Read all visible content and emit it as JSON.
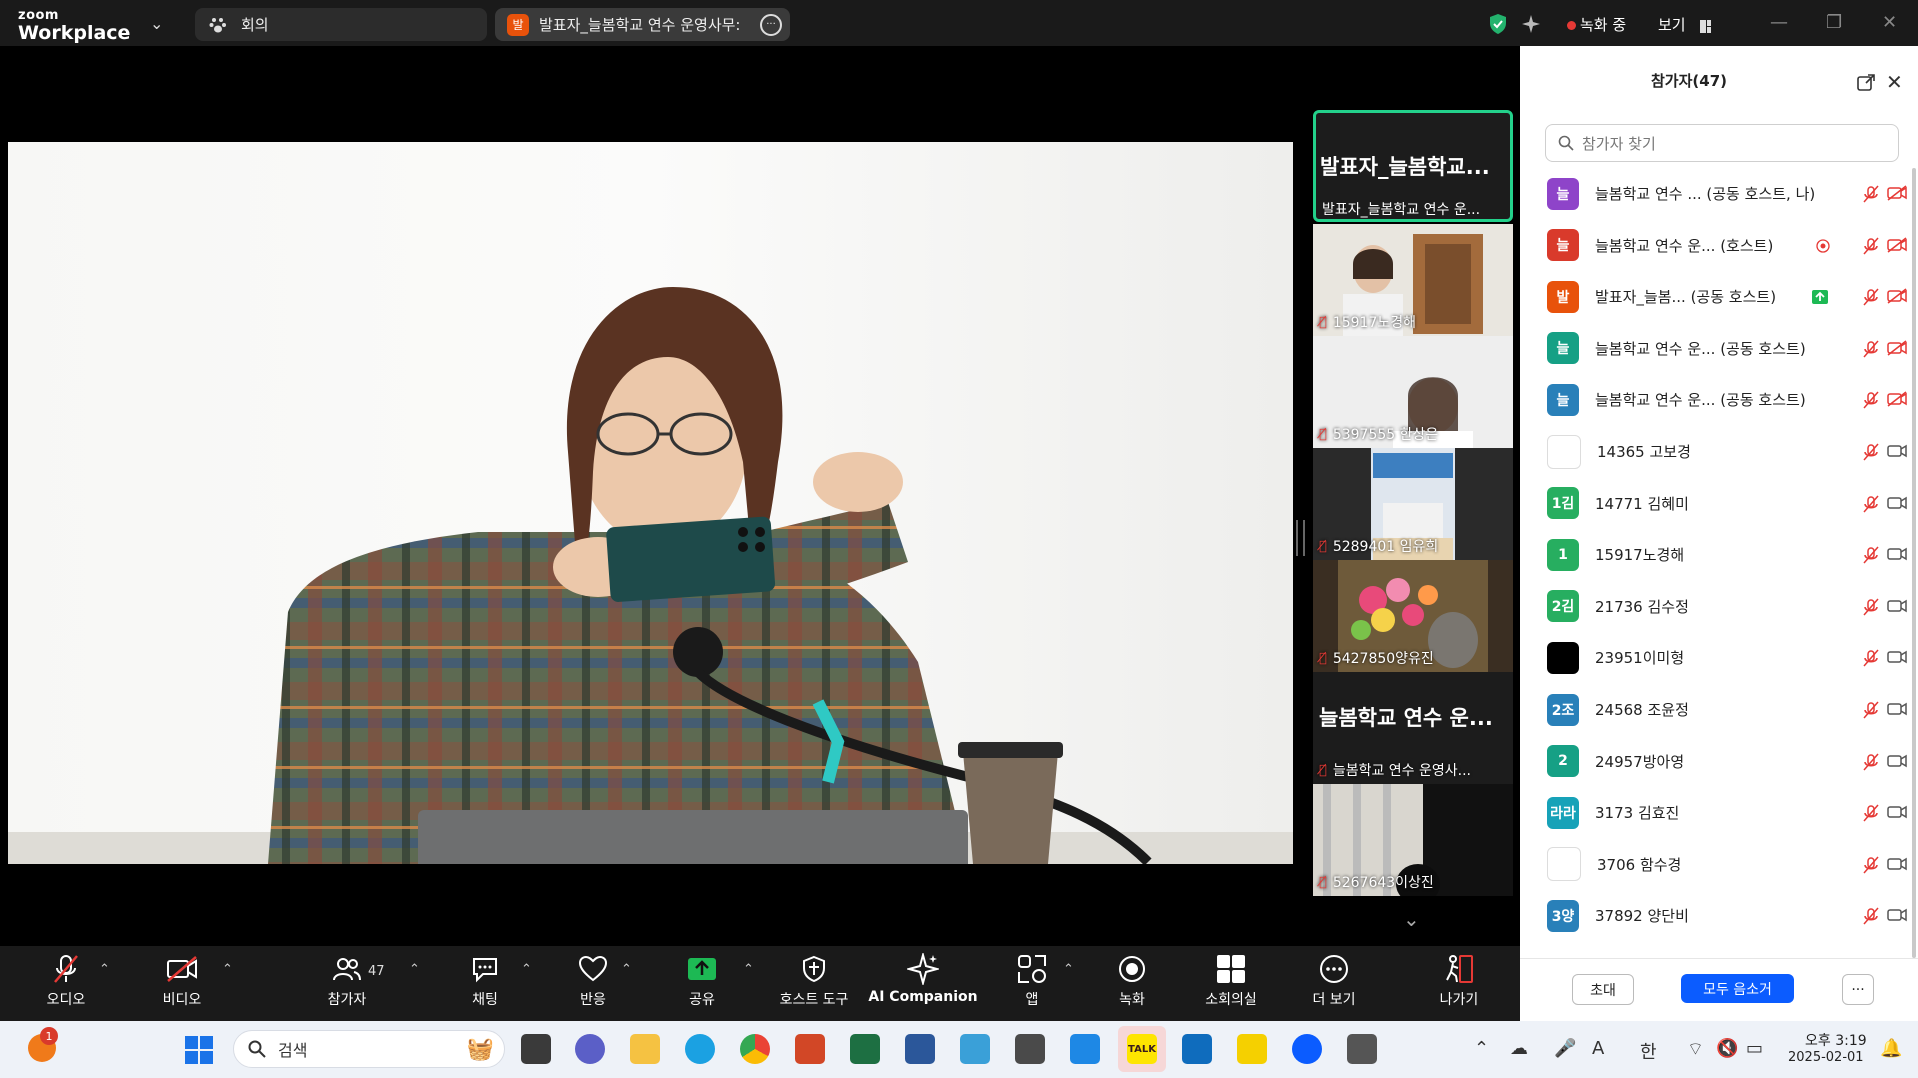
{
  "app": {
    "brand_small": "zoom",
    "brand_big": "Workplace"
  },
  "tabs": [
    {
      "label": "회의"
    },
    {
      "badge": "발",
      "label": "발표자_늘봄학교 연수 운영사무:"
    }
  ],
  "topbar": {
    "recording": "녹화 중",
    "view": "보기"
  },
  "thumbnails": [
    {
      "big": "발표자_늘봄학교...",
      "small": "발표자_늘봄학교 연수 운..."
    },
    {
      "label": "15917노경해"
    },
    {
      "label": "5397555 한상은"
    },
    {
      "label": "5289401 임유희"
    },
    {
      "label": "5427850양유진"
    },
    {
      "big": "늘봄학교 연수 운...",
      "small": "늘봄학교 연수 운영사..."
    },
    {
      "label": "5267643이상진"
    }
  ],
  "participants_panel": {
    "title": "참가자(47)",
    "search_placeholder": "참가자 찾기",
    "rows": [
      {
        "avatar": "늘",
        "color": "#8e44c9",
        "name": "늘봄학교 연수 ... (공동 호스트, 나)"
      },
      {
        "avatar": "늘",
        "color": "#d93a2b",
        "name": "늘봄학교 연수 운...    (호스트)"
      },
      {
        "avatar": "발",
        "color": "#e8520b",
        "name": "발표자_늘봄...    (공동 호스트)"
      },
      {
        "avatar": "늘",
        "color": "#16a085",
        "name": "늘봄학교 연수 운...   (공동 호스트)"
      },
      {
        "avatar": "늘",
        "color": "#2980b9",
        "name": "늘봄학교 연수 운...   (공동 호스트)"
      },
      {
        "avatar": "",
        "color": "#ffffff",
        "name": "14365 고보경"
      },
      {
        "avatar": "1김",
        "color": "#27ae60",
        "name": "14771 김혜미"
      },
      {
        "avatar": "1",
        "color": "#27ae60",
        "name": "15917노경해"
      },
      {
        "avatar": "2김",
        "color": "#27ae60",
        "name": "21736 김수정"
      },
      {
        "avatar": "",
        "color": "#000000",
        "name": "23951이미형"
      },
      {
        "avatar": "2조",
        "color": "#2980b9",
        "name": "24568 조윤정"
      },
      {
        "avatar": "2",
        "color": "#16a085",
        "name": "24957방아영"
      },
      {
        "avatar": "라라",
        "color": "#17a2b8",
        "name": "3173 김효진"
      },
      {
        "avatar": "",
        "color": "#ffffff",
        "name": "3706 함수경"
      },
      {
        "avatar": "3양",
        "color": "#2980b9",
        "name": "37892 양단비"
      }
    ],
    "buttons": {
      "invite": "초대",
      "mute_all": "모두 음소거",
      "more": "···"
    }
  },
  "toolbar": {
    "items": [
      {
        "label": "오디오"
      },
      {
        "label": "비디오"
      },
      {
        "label": "참가자",
        "count": "47"
      },
      {
        "label": "채팅"
      },
      {
        "label": "반응"
      },
      {
        "label": "공유"
      },
      {
        "label": "호스트 도구"
      },
      {
        "label": "AI Companion"
      },
      {
        "label": "앱"
      },
      {
        "label": "녹화"
      },
      {
        "label": "소회의실"
      },
      {
        "label": "더 보기"
      },
      {
        "label": "나가기"
      }
    ]
  },
  "taskbar": {
    "search": "검색",
    "notification_count": "1",
    "ime": "한",
    "font_mode": "A",
    "time": "오후 3:19",
    "date": "2025-02-01"
  },
  "colors": {
    "accent": "#0b5cff",
    "active_border": "#23d18b",
    "record": "#e53935",
    "share": "#1db954"
  }
}
